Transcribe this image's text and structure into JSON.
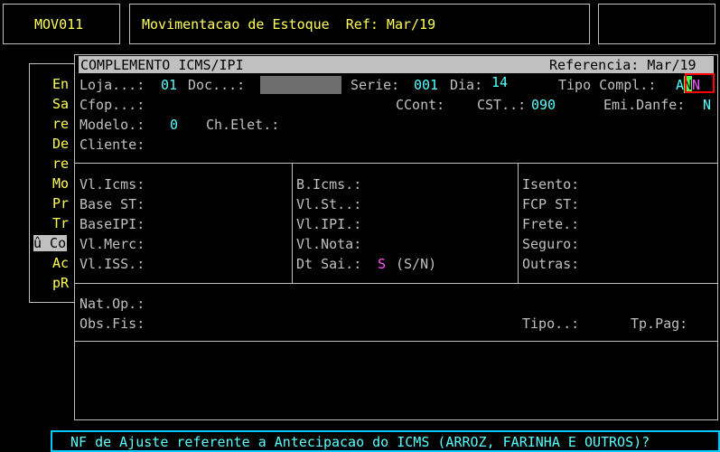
{
  "header": {
    "program_code": "MOV011",
    "title": "Movimentacao de Estoque  Ref: Mar/19"
  },
  "side_menu": {
    "items": [
      "En",
      "Sa",
      "re",
      "De",
      "re",
      "Mo",
      "Pr",
      "Tr",
      "û Co",
      "Ac",
      "pR"
    ],
    "selected_index": 8
  },
  "dialog": {
    "title": "COMPLEMENTO ICMS/IPI",
    "reference_label": "Referencia: Mar/19",
    "loja_label": "Loja...:",
    "loja_value": "01",
    "doc_label": "Doc...:",
    "serie_label": "Serie:",
    "serie_value": "001",
    "dia_label": "Dia:",
    "dia_value": "14",
    "tipo_compl_label": "Tipo Compl.:",
    "tipo_compl_value_1": "A",
    "tipo_compl_value_2": "N",
    "tipo_compl_value_3": "N",
    "cfop_label": "Cfop...:",
    "ccont_label": "CCont:",
    "cst_label": "CST..:",
    "cst_value": "090",
    "emi_danfe_label": "Emi.Danfe:",
    "emi_danfe_value": "N",
    "modelo_label": "Modelo.:",
    "modelo_value": "0",
    "ch_elet_label": "Ch.Elet.:",
    "cliente_label": "Cliente:",
    "col1": [
      "Vl.Icms:",
      "Base ST:",
      "BaseIPI:",
      "Vl.Merc:",
      "Vl.ISS.:"
    ],
    "col2": [
      "B.Icms.:",
      "Vl.St..:",
      "Vl.IPI.:",
      "Vl.Nota:",
      "Dt Sai.:"
    ],
    "dt_sai_value": "S",
    "dt_sai_hint": "(S/N)",
    "col3": [
      "Isento:",
      "FCP ST:",
      "Frete.:",
      "Seguro:",
      "Outras:"
    ],
    "nat_op_label": "Nat.Op.:",
    "obs_fis_label": "Obs.Fis:",
    "tipo_label": "Tipo..:",
    "tp_pag_label": "Tp.Pag:"
  },
  "status_message": "NF de Ajuste referente a Antecipacao do ICMS (ARROZ, FARINHA E OUTROS)?",
  "colors": {
    "background": "#000000",
    "label": "#c0c0c0",
    "header_text": "#ffff55",
    "value": "#55ffff",
    "highlight": "#ff55ff",
    "focus_border": "#ff0000",
    "title_bar": "#c0c0c0"
  }
}
